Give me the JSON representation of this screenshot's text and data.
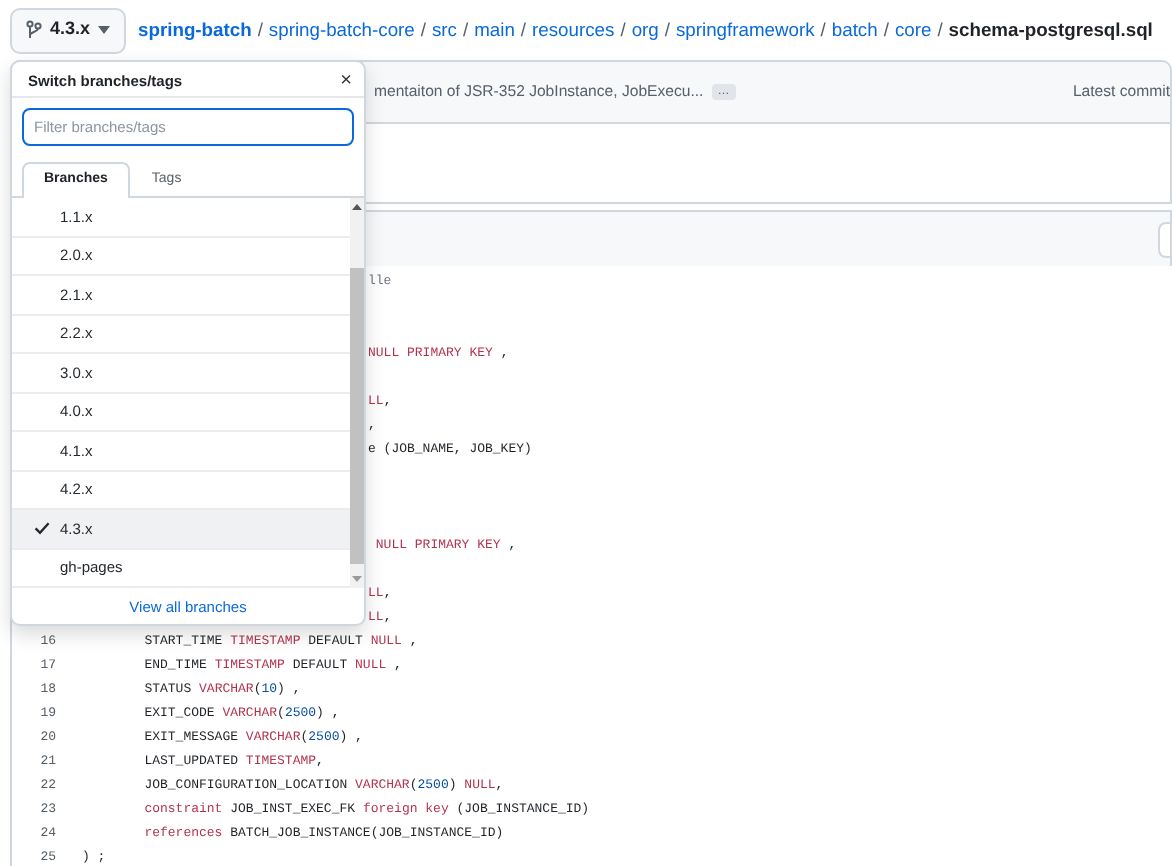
{
  "branch_button": {
    "label": "4.3.x"
  },
  "breadcrumb": [
    {
      "text": "spring-batch",
      "kind": "repo"
    },
    {
      "text": "spring-batch-core",
      "kind": "dir"
    },
    {
      "text": "src",
      "kind": "dir"
    },
    {
      "text": "main",
      "kind": "dir"
    },
    {
      "text": "resources",
      "kind": "dir"
    },
    {
      "text": "org",
      "kind": "dir"
    },
    {
      "text": "springframework",
      "kind": "dir"
    },
    {
      "text": "batch",
      "kind": "dir"
    },
    {
      "text": "core",
      "kind": "dir"
    },
    {
      "text": "schema-postgresql.sql",
      "kind": "file"
    }
  ],
  "separator": "/",
  "commit_bar": {
    "message": "mentaiton of JSR-352 JobInstance, JobExecu...",
    "more": "…",
    "latest": "Latest commit"
  },
  "branch_menu": {
    "title": "Switch branches/tags",
    "close": "×",
    "filter_placeholder": "Filter branches/tags",
    "tabs": [
      {
        "label": "Branches",
        "selected": true
      },
      {
        "label": "Tags",
        "selected": false
      }
    ],
    "items": [
      {
        "label": "1.1.x",
        "selected": false
      },
      {
        "label": "2.0.x",
        "selected": false
      },
      {
        "label": "2.1.x",
        "selected": false
      },
      {
        "label": "2.2.x",
        "selected": false
      },
      {
        "label": "3.0.x",
        "selected": false
      },
      {
        "label": "4.0.x",
        "selected": false
      },
      {
        "label": "4.1.x",
        "selected": false
      },
      {
        "label": "4.2.x",
        "selected": false
      },
      {
        "label": "4.3.x",
        "selected": true
      },
      {
        "label": "gh-pages",
        "selected": false
      }
    ],
    "footer_link": "View all branches"
  },
  "code_lines": [
    {
      "kind": "partial",
      "tokens": [
        {
          "text": "lle",
          "kind": "comment"
        }
      ]
    },
    {
      "kind": "blank"
    },
    {
      "kind": "blank"
    },
    {
      "kind": "partial",
      "tokens": [
        {
          "text": "NULL PRIMARY KEY",
          "kind": "keyword"
        },
        {
          "text": " ,",
          "kind": "plain"
        }
      ]
    },
    {
      "kind": "blank"
    },
    {
      "kind": "partial",
      "tokens": [
        {
          "text": "LL",
          "kind": "keyword"
        },
        {
          "text": ",",
          "kind": "plain"
        }
      ]
    },
    {
      "kind": "partial",
      "tokens": [
        {
          "text": ",",
          "kind": "plain"
        }
      ]
    },
    {
      "kind": "partial",
      "tokens": [
        {
          "text": "e (JOB_NAME, JOB_KEY)",
          "kind": "plain"
        }
      ]
    },
    {
      "kind": "blank"
    },
    {
      "kind": "blank"
    },
    {
      "kind": "blank"
    },
    {
      "kind": "partial",
      "tokens": [
        {
          "text": " NULL PRIMARY KEY",
          "kind": "keyword"
        },
        {
          "text": " ,",
          "kind": "plain"
        }
      ]
    },
    {
      "kind": "blank"
    },
    {
      "kind": "partial",
      "tokens": [
        {
          "text": "LL",
          "kind": "keyword"
        },
        {
          "text": ",",
          "kind": "plain"
        }
      ]
    },
    {
      "kind": "partial",
      "tokens": [
        {
          "text": "LL",
          "kind": "keyword"
        },
        {
          "text": ",",
          "kind": "plain"
        }
      ]
    },
    {
      "kind": "full",
      "number": "16",
      "tokens": [
        {
          "text": "        START_TIME ",
          "kind": "plain"
        },
        {
          "text": "TIMESTAMP",
          "kind": "keyword"
        },
        {
          "text": " DEFAULT ",
          "kind": "plain"
        },
        {
          "text": "NULL",
          "kind": "keyword"
        },
        {
          "text": " ,",
          "kind": "plain"
        }
      ]
    },
    {
      "kind": "full",
      "number": "17",
      "tokens": [
        {
          "text": "        END_TIME ",
          "kind": "plain"
        },
        {
          "text": "TIMESTAMP",
          "kind": "keyword"
        },
        {
          "text": " DEFAULT ",
          "kind": "plain"
        },
        {
          "text": "NULL",
          "kind": "keyword"
        },
        {
          "text": " ,",
          "kind": "plain"
        }
      ]
    },
    {
      "kind": "full",
      "number": "18",
      "tokens": [
        {
          "text": "        STATUS ",
          "kind": "plain"
        },
        {
          "text": "VARCHAR",
          "kind": "keyword"
        },
        {
          "text": "(",
          "kind": "plain"
        },
        {
          "text": "10",
          "kind": "number"
        },
        {
          "text": ") ,",
          "kind": "plain"
        }
      ]
    },
    {
      "kind": "full",
      "number": "19",
      "tokens": [
        {
          "text": "        EXIT_CODE ",
          "kind": "plain"
        },
        {
          "text": "VARCHAR",
          "kind": "keyword"
        },
        {
          "text": "(",
          "kind": "plain"
        },
        {
          "text": "2500",
          "kind": "number"
        },
        {
          "text": ") ,",
          "kind": "plain"
        }
      ]
    },
    {
      "kind": "full",
      "number": "20",
      "tokens": [
        {
          "text": "        EXIT_MESSAGE ",
          "kind": "plain"
        },
        {
          "text": "VARCHAR",
          "kind": "keyword"
        },
        {
          "text": "(",
          "kind": "plain"
        },
        {
          "text": "2500",
          "kind": "number"
        },
        {
          "text": ") ,",
          "kind": "plain"
        }
      ]
    },
    {
      "kind": "full",
      "number": "21",
      "tokens": [
        {
          "text": "        LAST_UPDATED ",
          "kind": "plain"
        },
        {
          "text": "TIMESTAMP",
          "kind": "keyword"
        },
        {
          "text": ",",
          "kind": "plain"
        }
      ]
    },
    {
      "kind": "full",
      "number": "22",
      "tokens": [
        {
          "text": "        JOB_CONFIGURATION_LOCATION ",
          "kind": "plain"
        },
        {
          "text": "VARCHAR",
          "kind": "keyword"
        },
        {
          "text": "(",
          "kind": "plain"
        },
        {
          "text": "2500",
          "kind": "number"
        },
        {
          "text": ") ",
          "kind": "plain"
        },
        {
          "text": "NULL",
          "kind": "keyword"
        },
        {
          "text": ",",
          "kind": "plain"
        }
      ]
    },
    {
      "kind": "full",
      "number": "23",
      "tokens": [
        {
          "text": "        constraint",
          "kind": "keyword"
        },
        {
          "text": " JOB_INST_EXEC_FK ",
          "kind": "plain"
        },
        {
          "text": "foreign key",
          "kind": "keyword"
        },
        {
          "text": " (JOB_INSTANCE_ID)",
          "kind": "plain"
        }
      ]
    },
    {
      "kind": "full",
      "number": "24",
      "tokens": [
        {
          "text": "        references",
          "kind": "keyword"
        },
        {
          "text": " BATCH_JOB_INSTANCE(JOB_INSTANCE_ID)",
          "kind": "plain"
        }
      ]
    },
    {
      "kind": "full",
      "number": "25",
      "tokens": [
        {
          "text": ") ;",
          "kind": "plain"
        }
      ]
    }
  ]
}
